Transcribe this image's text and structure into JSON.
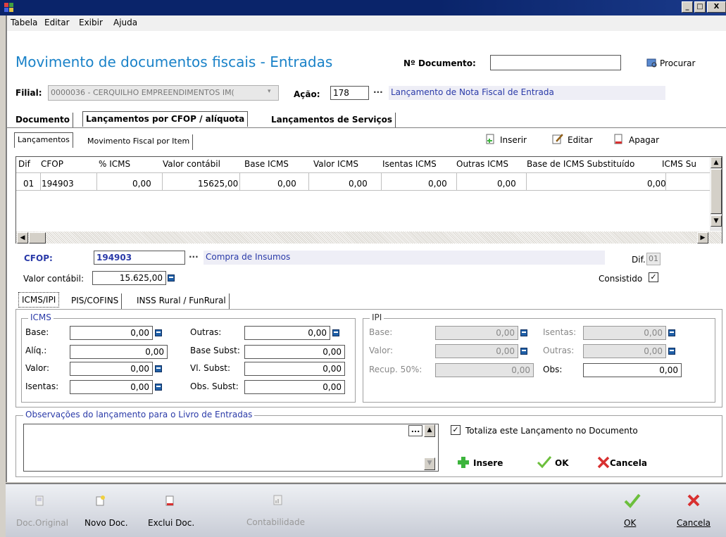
{
  "window": {
    "minimize": "_",
    "maximize": "□",
    "close": "X"
  },
  "menu": {
    "items": [
      "Tabela",
      "Editar",
      "Exibir",
      "Ajuda"
    ]
  },
  "header": {
    "title": "Movimento de documentos fiscais - Entradas",
    "doc_number_label": "Nº Documento:",
    "doc_number_value": "",
    "search_label": "Procurar",
    "filial_label": "Filial:",
    "filial_value": "0000036 - CERQUILHO EMPREENDIMENTOS IM(",
    "acao_label": "Ação:",
    "acao_value": "178",
    "acao_desc": "Lançamento de Nota Fiscal de Entrada",
    "ellipsis": "..."
  },
  "main_tabs": [
    "Documento",
    "Lançamentos por CFOP / alíquota",
    "Lançamentos de Serviços"
  ],
  "sub_tabs": [
    "Lançamentos",
    "Movimento Fiscal por Item"
  ],
  "grid_actions": {
    "insert": "Inserir",
    "edit": "Editar",
    "delete": "Apagar"
  },
  "grid": {
    "columns": [
      "Dif",
      "CFOP",
      "% ICMS",
      "Valor contábil",
      "Base ICMS",
      "Valor ICMS",
      "Isentas ICMS",
      "Outras ICMS",
      "Base de ICMS Substituído",
      "ICMS Su"
    ],
    "rows": [
      {
        "dif": "01",
        "cfop": "194903",
        "pct_icms": "0,00",
        "valor_contabil": "15625,00",
        "base_icms": "0,00",
        "valor_icms": "0,00",
        "isentas_icms": "0,00",
        "outras_icms": "0,00",
        "base_subst": "0,00"
      }
    ]
  },
  "detail": {
    "cfop_label": "CFOP:",
    "cfop_value": "194903",
    "cfop_desc": "Compra de Insumos",
    "dif_label": "Dif.:",
    "dif_value": "01",
    "valor_contabil_label": "Valor contábil:",
    "valor_contabil_value": "15.625,00",
    "consistido_label": "Consistido",
    "consistido_checked": true
  },
  "tax_tabs": [
    "ICMS/IPI",
    "PIS/COFINS",
    "INSS Rural / FunRural"
  ],
  "icms": {
    "title": "ICMS",
    "base_label": "Base:",
    "base_value": "0,00",
    "aliq_label": "Alíq.:",
    "aliq_value": "0,00",
    "valor_label": "Valor:",
    "valor_value": "0,00",
    "isentas_label": "Isentas:",
    "isentas_value": "0,00",
    "outras_label": "Outras:",
    "outras_value": "0,00",
    "base_subst_label": "Base Subst:",
    "base_subst_value": "0,00",
    "vl_subst_label": "Vl. Subst:",
    "vl_subst_value": "0,00",
    "obs_subst_label": "Obs. Subst:",
    "obs_subst_value": "0,00"
  },
  "ipi": {
    "title": "IPI",
    "base_label": "Base:",
    "base_value": "0,00",
    "valor_label": "Valor:",
    "valor_value": "0,00",
    "recup_label": "Recup. 50%:",
    "recup_value": "0,00",
    "isentas_label": "Isentas:",
    "isentas_value": "0,00",
    "outras_label": "Outras:",
    "outras_value": "0,00",
    "obs_label": "Obs:",
    "obs_value": "0,00"
  },
  "observacoes": {
    "title": "Observações do lançamento para o Livro de Entradas",
    "text": "",
    "totaliza_label": "Totaliza este Lançamento no Documento",
    "totaliza_checked": true,
    "insere_label": "Insere",
    "ok_label": "OK",
    "cancela_label": "Cancela"
  },
  "bottom_toolbar": {
    "doc_original": "Doc.Original",
    "novo_doc": "Novo Doc.",
    "exclui_doc": "Exclui Doc.",
    "contabilidade": "Contabilidade",
    "ok": "OK",
    "cancela": "Cancela"
  },
  "colors": {
    "title_blue": "#1a82c8",
    "accent_blue": "#0a246a",
    "green": "#3cb43c",
    "red": "#d83030"
  }
}
